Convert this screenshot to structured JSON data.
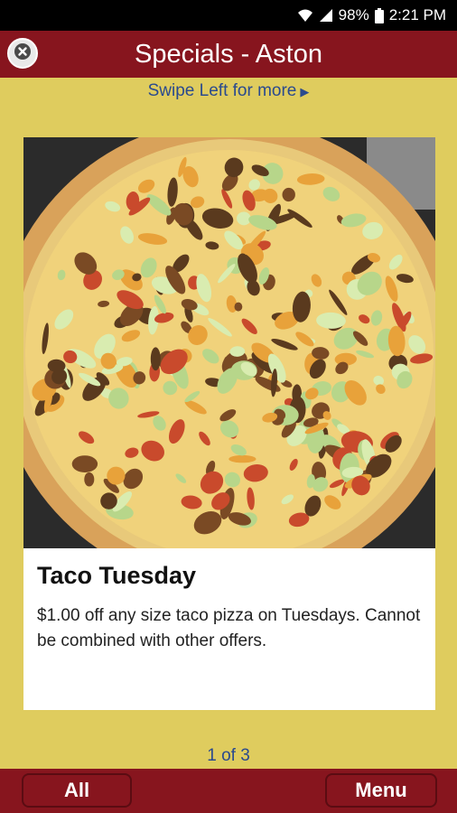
{
  "status_bar": {
    "battery": "98%",
    "time": "2:21 PM",
    "icons": [
      "wifi-icon",
      "signal-icon",
      "battery-icon"
    ]
  },
  "header": {
    "title": "Specials - Aston",
    "close_icon": "close-icon"
  },
  "swipe_hint": {
    "text": "Swipe Left for more",
    "arrow": "▶"
  },
  "special": {
    "title": "Taco Tuesday",
    "description": "$1.00 off any size taco pizza on Tuesdays. Cannot be combined with other offers.",
    "image": "taco-pizza-photo"
  },
  "pager": {
    "text": "1 of 3"
  },
  "bottom_nav": {
    "all_label": "All",
    "menu_label": "Menu"
  },
  "colors": {
    "header_bg": "#87151e",
    "page_bg": "#dfcc5e",
    "link_text": "#2a4a8e"
  }
}
